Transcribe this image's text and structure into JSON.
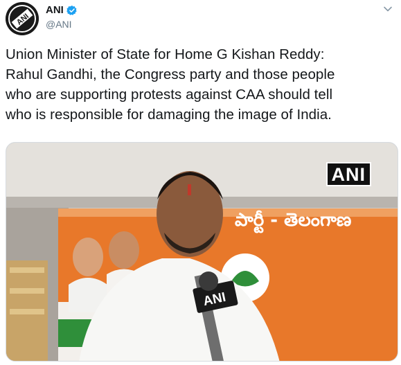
{
  "account": {
    "display_name": "ANI",
    "handle": "@ANI",
    "avatar_text": "ANI",
    "verified": true
  },
  "tweet": {
    "text_lines": [
      "Union Minister of State for Home G Kishan Reddy:",
      "Rahul Gandhi, the Congress party and those people",
      "who are supporting protests against CAA should tell",
      "who is responsible for damaging the image of India."
    ]
  },
  "media": {
    "watermark": "ANI",
    "mic_label": "ANI",
    "banner_text": "పార్టీ - తెలంగాణ"
  },
  "colors": {
    "verified": "#1da1f2",
    "handle": "#657786",
    "text": "#14171a",
    "banner_orange": "#e8782a"
  }
}
